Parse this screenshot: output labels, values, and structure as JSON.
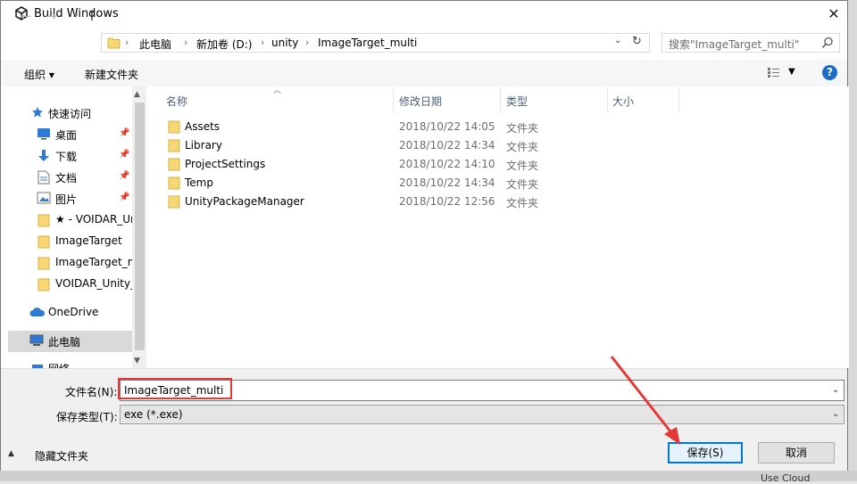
{
  "window": {
    "title": "Build Windows",
    "close_glyph": "✕"
  },
  "nav": {
    "breadcrumbs": [
      "此电脑",
      "新加卷 (D:)",
      "unity",
      "ImageTarget_multi"
    ],
    "search_placeholder": "搜索\"ImageTarget_multi\""
  },
  "toolbar": {
    "organize_label": "组织 ▾",
    "new_folder_label": "新建文件夹",
    "help_glyph": "?"
  },
  "sidebar": {
    "items": [
      {
        "label": "快速访问",
        "icon": "star-icon",
        "pinned": false
      },
      {
        "label": "桌面",
        "icon": "desktop-icon",
        "pinned": true
      },
      {
        "label": "下载",
        "icon": "download-icon",
        "pinned": true
      },
      {
        "label": "文档",
        "icon": "document-icon",
        "pinned": true
      },
      {
        "label": "图片",
        "icon": "picture-icon",
        "pinned": true
      },
      {
        "label": "★ - VOIDAR_Ur",
        "icon": "folder-icon",
        "pinned": false
      },
      {
        "label": "ImageTarget",
        "icon": "folder-icon",
        "pinned": false
      },
      {
        "label": "ImageTarget_n",
        "icon": "folder-icon",
        "pinned": false
      },
      {
        "label": "VOIDAR_Unity_",
        "icon": "folder-icon",
        "pinned": false
      },
      {
        "label": "OneDrive",
        "icon": "cloud-icon",
        "pinned": false
      },
      {
        "label": "此电脑",
        "icon": "computer-icon",
        "pinned": false,
        "selected": true
      },
      {
        "label": "网络",
        "icon": "network-icon",
        "pinned": false
      }
    ]
  },
  "filelist": {
    "columns": [
      "名称",
      "修改日期",
      "类型",
      "大小"
    ],
    "rows": [
      {
        "name": "Assets",
        "date": "2018/10/22 14:05",
        "type": "文件夹"
      },
      {
        "name": "Library",
        "date": "2018/10/22 14:34",
        "type": "文件夹"
      },
      {
        "name": "ProjectSettings",
        "date": "2018/10/22 14:10",
        "type": "文件夹"
      },
      {
        "name": "Temp",
        "date": "2018/10/22 14:34",
        "type": "文件夹"
      },
      {
        "name": "UnityPackageManager",
        "date": "2018/10/22 12:56",
        "type": "文件夹"
      }
    ]
  },
  "form": {
    "filename_label": "文件名(N):",
    "filename_value": "ImageTarget_multi",
    "type_label": "保存类型(T):",
    "type_value": "exe (*.exe)",
    "hide_folders_label": "隐藏文件夹",
    "save_label": "保存(S)",
    "cancel_label": "取消"
  },
  "background": {
    "use_cloud_text": "Use Cloud"
  },
  "colors": {
    "accent": "#0078d7",
    "annotation": "#e53935",
    "folder": "#f7d774"
  }
}
